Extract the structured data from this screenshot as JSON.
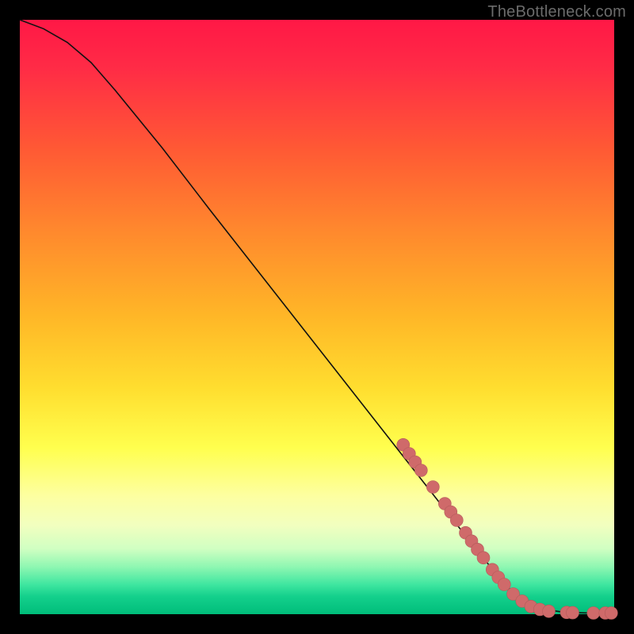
{
  "attribution": "TheBottleneck.com",
  "chart_data": {
    "type": "line",
    "title": "",
    "xlabel": "",
    "ylabel": "",
    "xlim": [
      0,
      100
    ],
    "ylim": [
      0,
      100
    ],
    "curve": [
      {
        "x": 0,
        "y": 100
      },
      {
        "x": 4,
        "y": 98.5
      },
      {
        "x": 8,
        "y": 96.2
      },
      {
        "x": 12,
        "y": 92.8
      },
      {
        "x": 16,
        "y": 88.2
      },
      {
        "x": 24,
        "y": 78.4
      },
      {
        "x": 32,
        "y": 68.0
      },
      {
        "x": 40,
        "y": 57.8
      },
      {
        "x": 48,
        "y": 47.6
      },
      {
        "x": 56,
        "y": 37.4
      },
      {
        "x": 64,
        "y": 27.2
      },
      {
        "x": 72,
        "y": 17.0
      },
      {
        "x": 78,
        "y": 9.4
      },
      {
        "x": 82,
        "y": 4.6
      },
      {
        "x": 85,
        "y": 2.0
      },
      {
        "x": 88,
        "y": 0.8
      },
      {
        "x": 92,
        "y": 0.3
      },
      {
        "x": 96,
        "y": 0.2
      },
      {
        "x": 100,
        "y": 0.2
      }
    ],
    "markers": [
      {
        "x": 64.5,
        "y": 28.5
      },
      {
        "x": 65.5,
        "y": 27.0
      },
      {
        "x": 66.5,
        "y": 25.6
      },
      {
        "x": 67.5,
        "y": 24.2
      },
      {
        "x": 69.5,
        "y": 21.4
      },
      {
        "x": 71.5,
        "y": 18.6
      },
      {
        "x": 72.5,
        "y": 17.2
      },
      {
        "x": 73.5,
        "y": 15.8
      },
      {
        "x": 75.0,
        "y": 13.7
      },
      {
        "x": 76.0,
        "y": 12.3
      },
      {
        "x": 77.0,
        "y": 10.9
      },
      {
        "x": 78.0,
        "y": 9.5
      },
      {
        "x": 79.5,
        "y": 7.5
      },
      {
        "x": 80.5,
        "y": 6.2
      },
      {
        "x": 81.5,
        "y": 5.0
      },
      {
        "x": 83.0,
        "y": 3.4
      },
      {
        "x": 84.5,
        "y": 2.2
      },
      {
        "x": 86.0,
        "y": 1.3
      },
      {
        "x": 87.5,
        "y": 0.8
      },
      {
        "x": 89.0,
        "y": 0.5
      },
      {
        "x": 92.0,
        "y": 0.3
      },
      {
        "x": 93.0,
        "y": 0.25
      },
      {
        "x": 96.5,
        "y": 0.2
      },
      {
        "x": 98.5,
        "y": 0.2
      },
      {
        "x": 99.5,
        "y": 0.2
      }
    ],
    "marker_color": "#cf6a6a"
  }
}
